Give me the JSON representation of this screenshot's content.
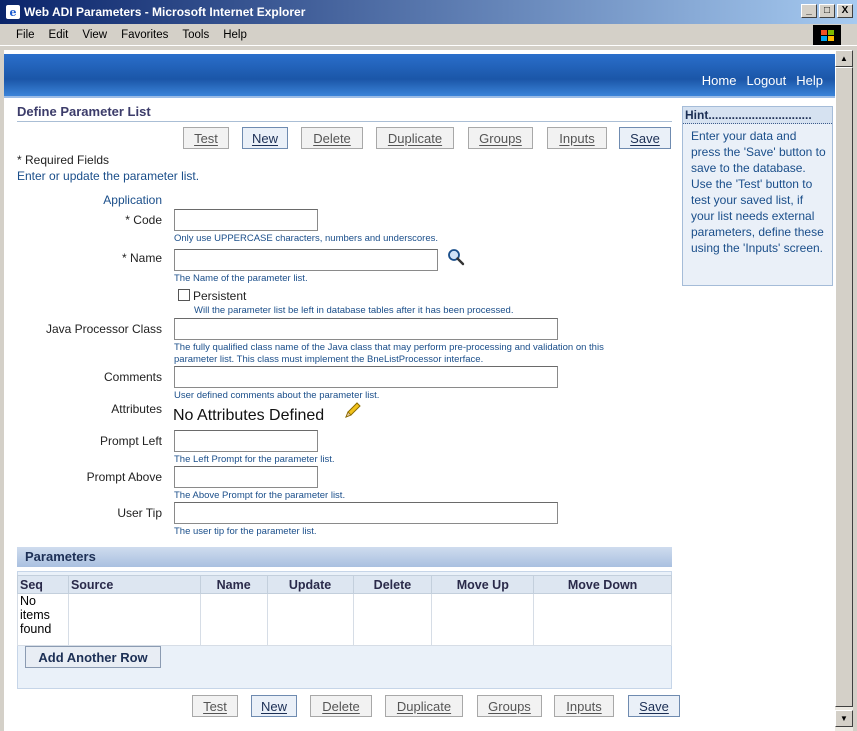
{
  "window": {
    "title": "Web ADI Parameters - Microsoft Internet Explorer",
    "min_label": "_",
    "max_label": "□",
    "close_label": "X"
  },
  "menubar": {
    "items": [
      "File",
      "Edit",
      "View",
      "Favorites",
      "Tools",
      "Help"
    ]
  },
  "globalnav": {
    "home": "Home",
    "logout": "Logout",
    "help": "Help"
  },
  "page": {
    "title": "Define Parameter List",
    "required_text": "* Required Fields",
    "instruction": "Enter or update the parameter list."
  },
  "buttons": {
    "test": "Test",
    "new": "New",
    "delete": "Delete",
    "duplicate": "Duplicate",
    "groups": "Groups",
    "inputs": "Inputs",
    "save": "Save"
  },
  "form": {
    "application_label": "Application",
    "code_label": "* Code",
    "code_value": "",
    "code_tip": "Only use UPPERCASE characters, numbers and underscores.",
    "name_label": "* Name",
    "name_value": "",
    "name_tip": "The Name of the parameter list.",
    "persistent_label": "Persistent",
    "persistent_checked": false,
    "persistent_tip": "Will the parameter list be left in database tables after it has been processed.",
    "java_label": "Java Processor Class",
    "java_value": "",
    "java_tip_1": "The fully qualified class name of the Java class that may perform pre-processing and validation on this",
    "java_tip_2": "parameter list. This class must implement the BneListProcessor interface.",
    "comments_label": "Comments",
    "comments_value": "",
    "comments_tip": "User defined comments about the parameter list.",
    "attributes_label": "Attributes",
    "attributes_value": "No Attributes Defined",
    "prompt_left_label": "Prompt Left",
    "prompt_left_value": "",
    "prompt_left_tip": "The Left Prompt for the parameter list.",
    "prompt_above_label": "Prompt Above",
    "prompt_above_value": "",
    "prompt_above_tip": "The Above Prompt for the parameter list.",
    "user_tip_label": "User Tip",
    "user_tip_value": "",
    "user_tip_tip": "The user tip for the parameter list."
  },
  "hint": {
    "title": "Hint...............................",
    "body": "Enter your data and press the 'Save' button to save to the database. Use the 'Test' button to test your saved list, if your list needs external parameters, define these using the 'Inputs' screen."
  },
  "parameters": {
    "header": "Parameters",
    "columns": [
      "Seq",
      "Source",
      "Name",
      "Update",
      "Delete",
      "Move Up",
      "Move Down"
    ],
    "empty_text": "No items found",
    "add_row": "Add Another Row"
  },
  "colors": {
    "accent": "#1a4e8a",
    "brand_band": "#1b56a8",
    "section_header": "#a9c0e0"
  }
}
